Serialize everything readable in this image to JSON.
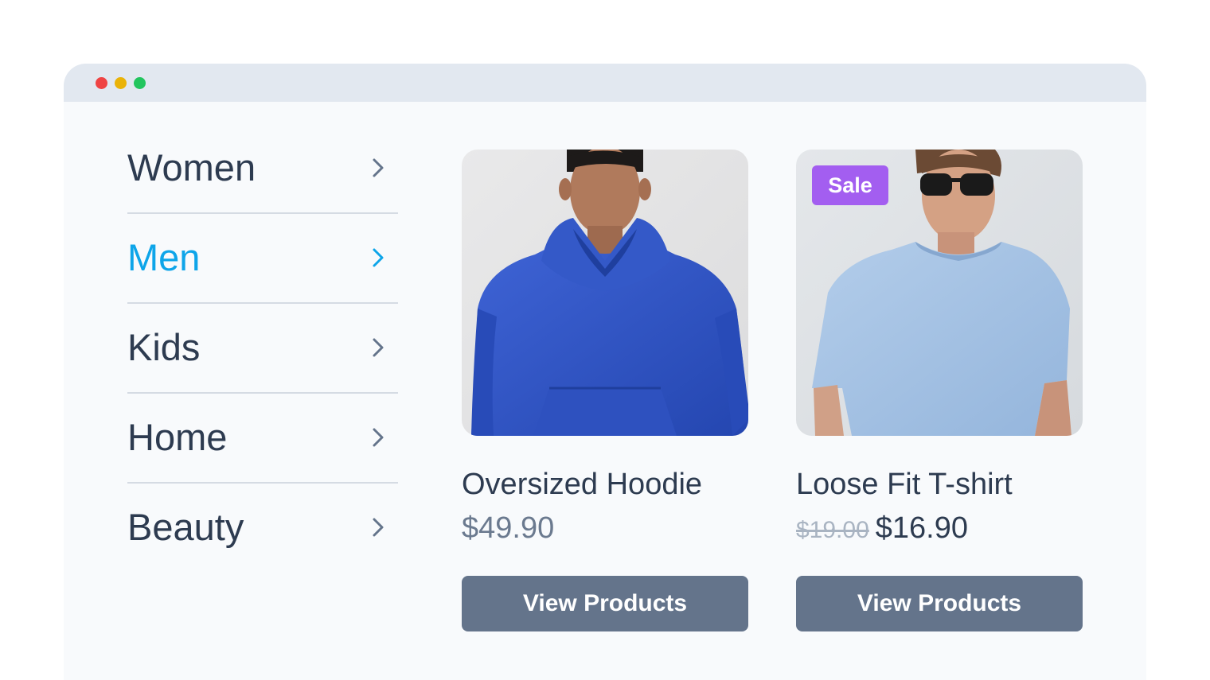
{
  "window": {
    "controls": [
      "close-dot",
      "minimize-dot",
      "maximize-dot"
    ],
    "colors": {
      "close": "#ef4444",
      "minimize": "#eab308",
      "maximize": "#22c55e"
    }
  },
  "menu": {
    "items": [
      {
        "label": "Women",
        "active": false
      },
      {
        "label": "Men",
        "active": true
      },
      {
        "label": "Kids",
        "active": false
      },
      {
        "label": "Home",
        "active": false
      },
      {
        "label": "Beauty",
        "active": false
      }
    ],
    "active_color": "#0ea5e9",
    "text_color": "#2d3b50"
  },
  "products": [
    {
      "name": "Oversized Hoodie",
      "price": "$49.90",
      "button_label": "View Products",
      "image": "man-in-blue-hoodie"
    },
    {
      "badge": "Sale",
      "name": "Loose Fit T-shirt",
      "old_price": "$19.00",
      "price": "$16.90",
      "button_label": "View Products",
      "image": "man-in-light-blue-tshirt-with-sunglasses"
    }
  ],
  "colors": {
    "button": "#64748b",
    "badge": "#a35ef0"
  }
}
